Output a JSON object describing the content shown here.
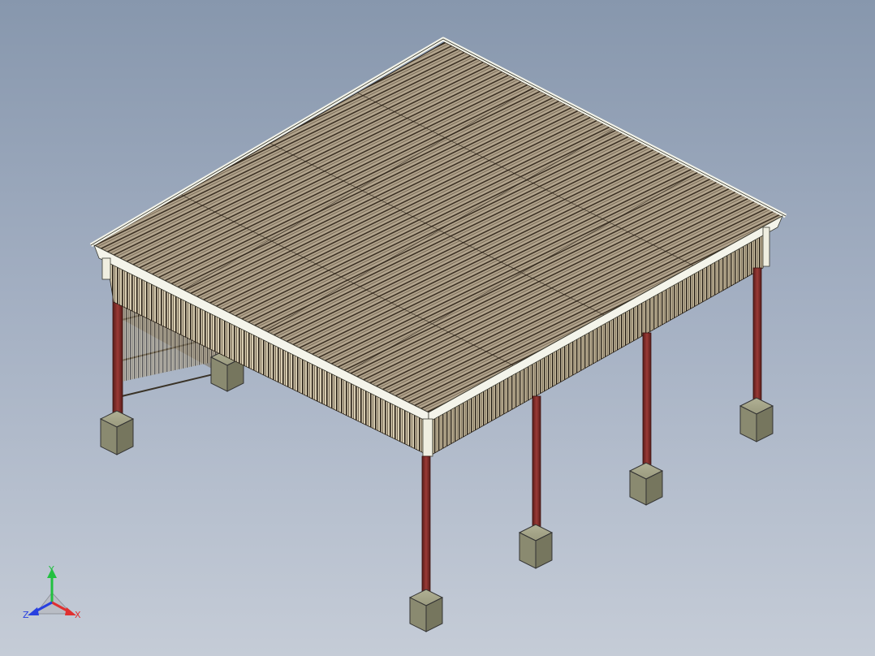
{
  "view": {
    "projection": "isometric",
    "background_top": "#8797ad",
    "background_bottom": "#c5ccd7"
  },
  "model": {
    "type": "carport / open shelter",
    "roof_color": "#a89a85",
    "roof_stripe_color": "#2a2218",
    "fascia_color": "#f4f4ea",
    "column_color": "#7a2a28",
    "footing_color": "#8f8f74",
    "column_count": 8
  },
  "triad": {
    "x_label": "X",
    "y_label": "Y",
    "z_label": "Z",
    "x_color": "#e03030",
    "y_color": "#22c040",
    "z_color": "#2840e0"
  }
}
